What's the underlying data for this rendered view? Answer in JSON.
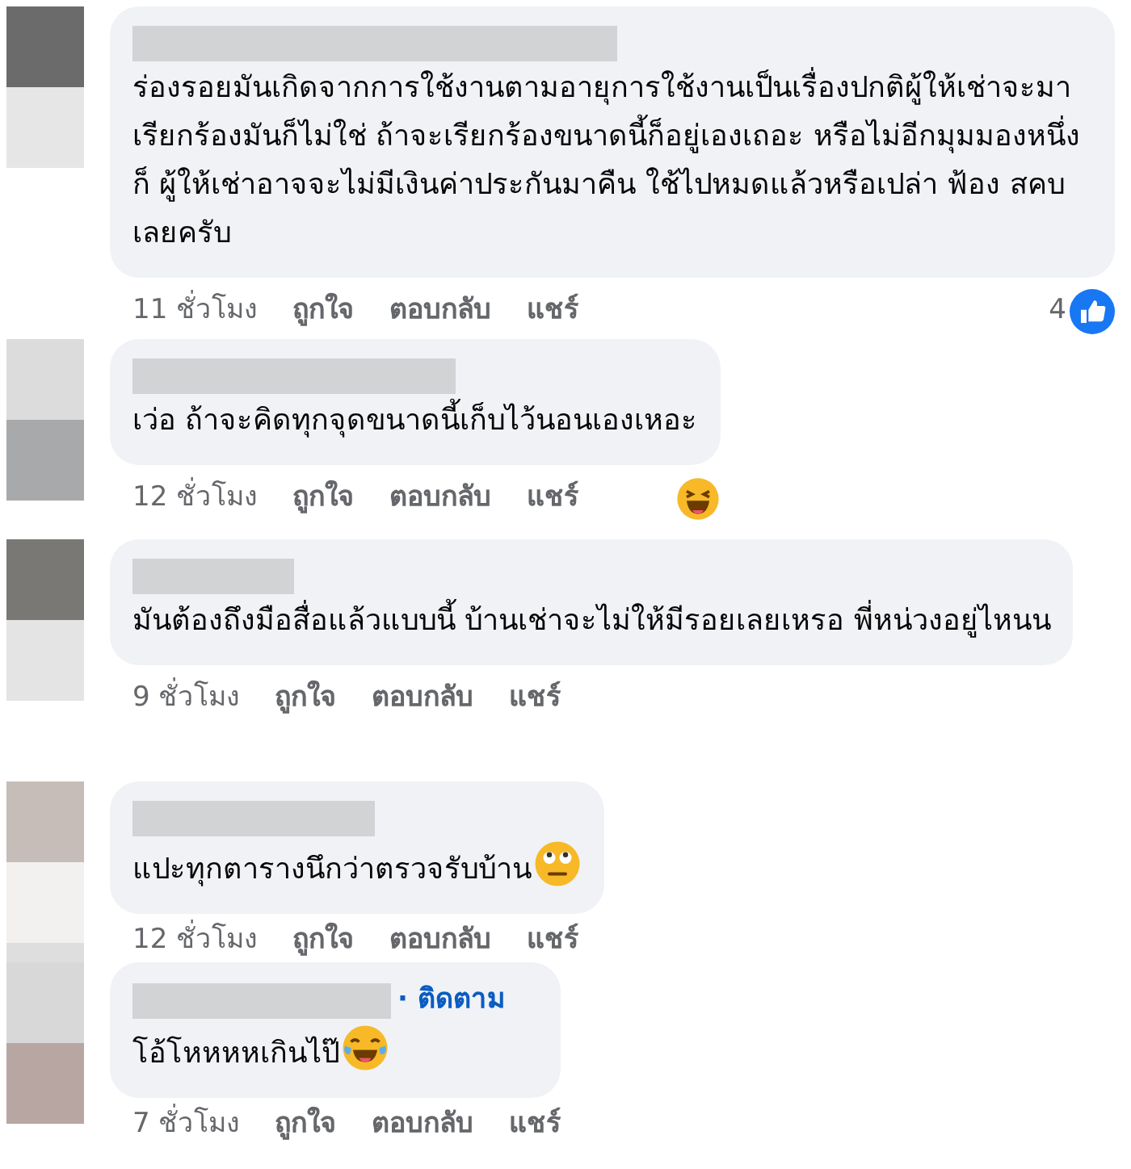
{
  "comments": [
    {
      "text": "ร่องรอยมันเกิดจากการใช้งานตามอายุการใช้งานเป็นเรื่องปกติผู้ให้เช่าจะมาเรียกร้องมันก็ไม่ใช่ ถ้าจะเรียกร้องขนาดนี้ก็อยู่เองเถอะ หรือไม่อีกมุมมองหนึ่งก็ ผู้ให้เช่าอาจจะไม่มีเงินค่าประกันมาคืน ใช้ไปหมดแล้วหรือเปล่า ฟ้อง สคบ เลยครับ",
      "time": "11 ชั่วโมง",
      "actions": [
        "ถูกใจ",
        "ตอบกลับ",
        "แชร์"
      ],
      "reaction": {
        "kind": "like",
        "count": "4"
      }
    },
    {
      "text": "เว่อ ถ้าจะคิดทุกจุดขนาดนี้เก็บไว้นอนเองเหอะ",
      "time": "12 ชั่วโมง",
      "actions": [
        "ถูกใจ",
        "ตอบกลับ",
        "แชร์"
      ],
      "reaction": {
        "kind": "haha"
      }
    },
    {
      "text": "มันต้องถึงมือสื่อแล้วแบบนี้ บ้านเช่าจะไม่ให้มีรอยเลยเหรอ พี่หน่วงอยู่ไหนน",
      "time": "9 ชั่วโมง",
      "actions": [
        "ถูกใจ",
        "ตอบกลับ",
        "แชร์"
      ]
    },
    {
      "text": "แปะทุกตารางนึกว่าตรวจรับบ้าน",
      "emoji": {
        "kind": "rolling-eyes"
      },
      "time": "12 ชั่วโมง",
      "actions": [
        "ถูกใจ",
        "ตอบกลับ",
        "แชร์"
      ]
    },
    {
      "text": "โอ้โหหหหเกินไป๊",
      "emoji": {
        "kind": "tears-of-joy"
      },
      "follow": "· ติดตาม",
      "time": "7 ชั่วโมง",
      "actions": [
        "ถูกใจ",
        "ตอบกลับ",
        "แชร์"
      ]
    }
  ]
}
